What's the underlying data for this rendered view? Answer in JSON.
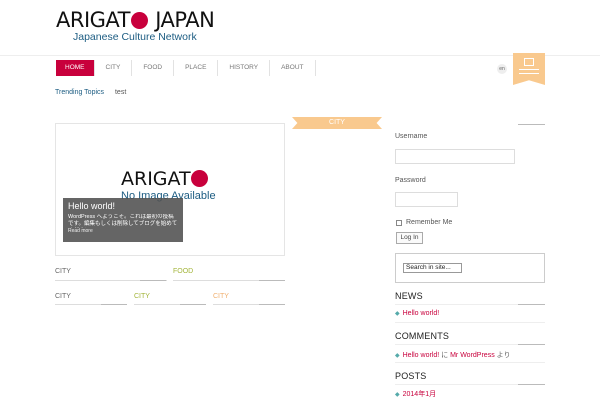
{
  "header": {
    "logo_left": "ARIGAT",
    "logo_right": "JAPAN",
    "tagline": "Japanese Culture Network"
  },
  "nav": {
    "items": [
      {
        "label": "HOME"
      },
      {
        "label": "CITY"
      },
      {
        "label": "FOOD"
      },
      {
        "label": "PLACE"
      },
      {
        "label": "HISTORY"
      },
      {
        "label": "ABOUT"
      }
    ],
    "lang": "en"
  },
  "trending": {
    "label": "Trending Topics",
    "value": "test"
  },
  "post": {
    "noimage_title": "ARIGAT",
    "noimage_sub": "No Image Available",
    "title": "Hello world!",
    "excerpt": "WordPress へようこそ。これは最初の投稿です。編集もしくは削除してブログを始めてください !",
    "more": "Read more",
    "category_tab": "CITY"
  },
  "categories": {
    "row1": [
      "CITY",
      "FOOD"
    ],
    "row2": [
      "CITY",
      "CITY",
      "CITY"
    ]
  },
  "login": {
    "username_label": "Username",
    "password_label": "Password",
    "remember_label": "Remember Me",
    "login_button": "Log In"
  },
  "search": {
    "placeholder": "Search in site..."
  },
  "widgets": {
    "news_title": "NEWS",
    "news_items": [
      "Hello world!"
    ],
    "comments_title": "COMMENTS",
    "comment_link": "Hello world!",
    "comment_sep": " に ",
    "comment_author": "Mr WordPress",
    "comment_suffix": " より",
    "posts_title": "POSTS",
    "posts_items": [
      "2014年1月"
    ]
  },
  "colors": {
    "accent": "#c8003c",
    "brand_blue": "#1c5c82",
    "ribbon": "#f9c98e",
    "food_green": "#a3b53a"
  }
}
